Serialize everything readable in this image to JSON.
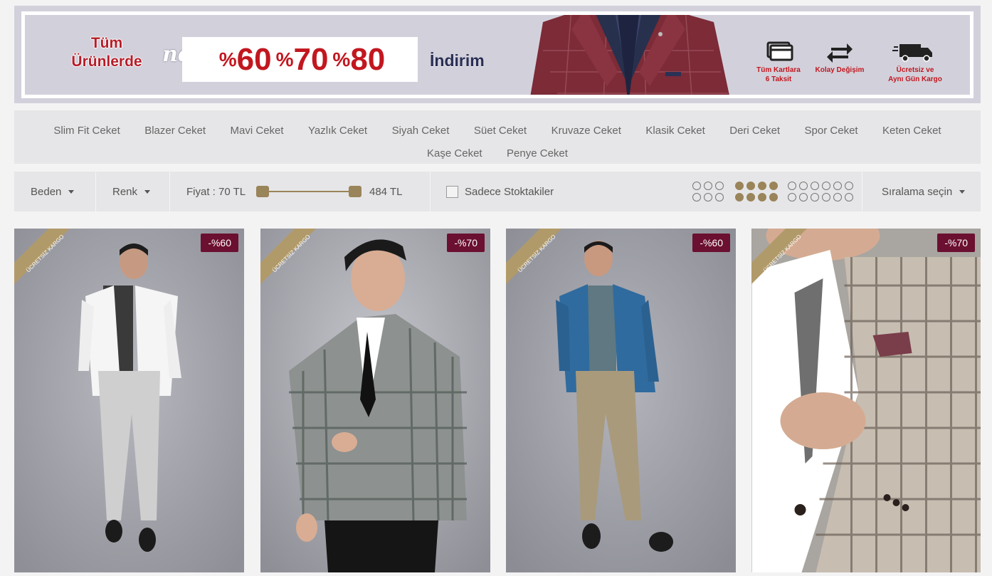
{
  "banner": {
    "tum_line1": "Tüm",
    "tum_line2": "Ürünlerde",
    "net": "net",
    "pct1": "60",
    "pct2": "70",
    "pct3": "80",
    "pct_symbol": "%",
    "indirim": "İndirim",
    "features": [
      {
        "icon": "credit-card-icon",
        "line1": "Tüm Kartlara",
        "line2": "6 Taksit"
      },
      {
        "icon": "exchange-icon",
        "line1": "Kolay Değişim",
        "line2": ""
      },
      {
        "icon": "truck-icon",
        "line1": "Ücretsiz ve",
        "line2": "Aynı Gün Kargo"
      }
    ]
  },
  "categories": [
    "Slim Fit Ceket",
    "Blazer Ceket",
    "Mavi Ceket",
    "Yazlık Ceket",
    "Siyah Ceket",
    "Süet Ceket",
    "Kruvaze Ceket",
    "Klasik Ceket",
    "Deri Ceket",
    "Spor Ceket",
    "Keten Ceket",
    "Kaşe Ceket",
    "Penye Ceket"
  ],
  "filters": {
    "size_label": "Beden",
    "color_label": "Renk",
    "price_label": "Fiyat : 70 TL",
    "price_max_label": "484 TL",
    "price_min": 70,
    "price_max": 484,
    "stock_label": "Sadece Stoktakiler",
    "stock_checked": false,
    "grid_options": [
      3,
      4,
      6
    ],
    "grid_selected": 4,
    "sort_label": "Sıralama seçin"
  },
  "products": [
    {
      "discount": "-%60",
      "ribbon": "ÜCRETSİZ KARGO"
    },
    {
      "discount": "-%70",
      "ribbon": "ÜCRETSİZ KARGO"
    },
    {
      "discount": "-%60",
      "ribbon": "ÜCRETSİZ KARGO"
    },
    {
      "discount": "-%70",
      "ribbon": "ÜCRETSİZ KARGO"
    }
  ],
  "colors": {
    "accent_gold": "#9a8459",
    "discount_badge": "#6b1030",
    "banner_red": "#c2171f"
  }
}
